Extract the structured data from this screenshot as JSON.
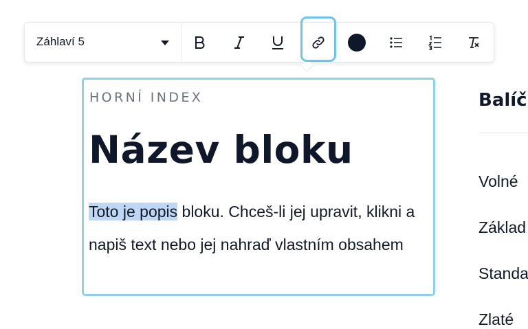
{
  "toolbar": {
    "style_select": {
      "value": "Záhlaví 5"
    },
    "buttons": [
      {
        "name": "bold-button",
        "icon": "bold-icon"
      },
      {
        "name": "italic-button",
        "icon": "italic-icon"
      },
      {
        "name": "underline-button",
        "icon": "underline-icon"
      },
      {
        "name": "link-button",
        "icon": "link-icon",
        "active": true
      },
      {
        "name": "text-color-button",
        "icon": "color-circle-icon",
        "color": "#0f172a"
      },
      {
        "name": "bulleted-list-button",
        "icon": "bullet-list-icon"
      },
      {
        "name": "numbered-list-button",
        "icon": "numbered-list-icon"
      },
      {
        "name": "clear-format-button",
        "icon": "clear-format-icon"
      }
    ],
    "active_highlight_color": "#6cc4ea"
  },
  "block": {
    "overline": "HORNÍ INDEX",
    "title": "Název bloku",
    "description_selected": "Toto je popis",
    "description_rest": " bloku. Chceš-li jej upravit, klikni a napiš text nebo jej nahraď vlastním obsahem",
    "border_color": "#8fd0ea",
    "selection_color": "#bfd7f5"
  },
  "side": {
    "title": "Balíč",
    "items": [
      "Volné",
      "Základ",
      "Standa",
      "Zlaté"
    ]
  }
}
